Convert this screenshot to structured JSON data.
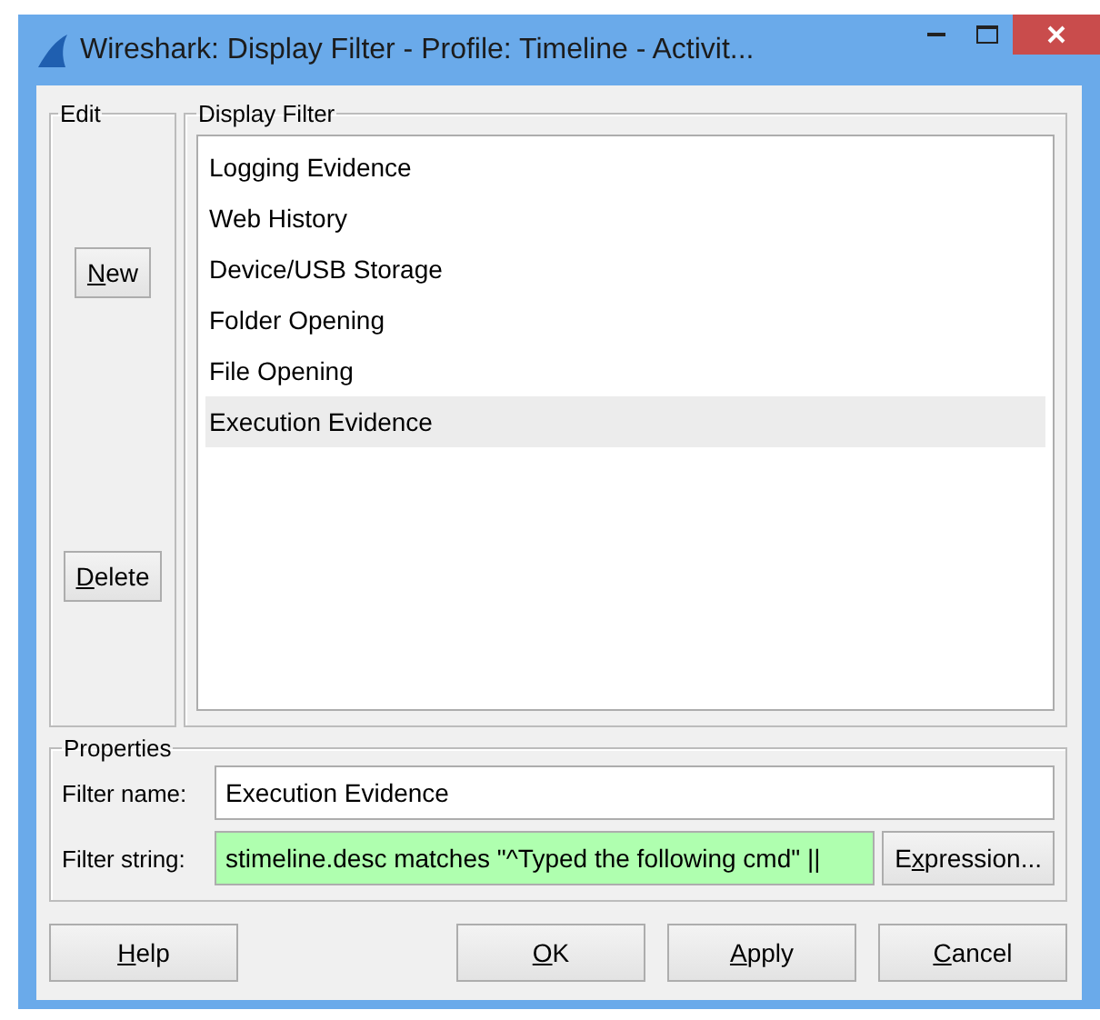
{
  "window": {
    "title": "Wireshark: Display Filter - Profile: Timeline - Activit..."
  },
  "edit_group": {
    "title": "Edit",
    "buttons": [
      {
        "key": "N",
        "post": "ew"
      },
      {
        "key": "D",
        "post": "elete"
      }
    ]
  },
  "display_filter": {
    "title": "Display Filter",
    "items": [
      {
        "label": "Logging Evidence",
        "selected": false
      },
      {
        "label": "Web History",
        "selected": false
      },
      {
        "label": "Device/USB Storage",
        "selected": false
      },
      {
        "label": "Folder Opening",
        "selected": false
      },
      {
        "label": "File Opening",
        "selected": false
      },
      {
        "label": "Execution Evidence",
        "selected": true
      }
    ]
  },
  "properties": {
    "title": "Properties",
    "filter_name_label": "Filter name:",
    "filter_name": "Execution Evidence",
    "filter_string_label": "Filter string:",
    "filter_string": "stimeline.desc matches \"^Typed the following cmd\" ||",
    "filter_valid": true,
    "expression_button": {
      "pre": "E",
      "key": "x",
      "post": "pression..."
    }
  },
  "footer_buttons": [
    {
      "key": "H",
      "post": "elp"
    },
    {
      "key": "O",
      "post": "K"
    },
    {
      "key": "A",
      "post": "pply"
    },
    {
      "key": "C",
      "post": "ancel"
    }
  ]
}
